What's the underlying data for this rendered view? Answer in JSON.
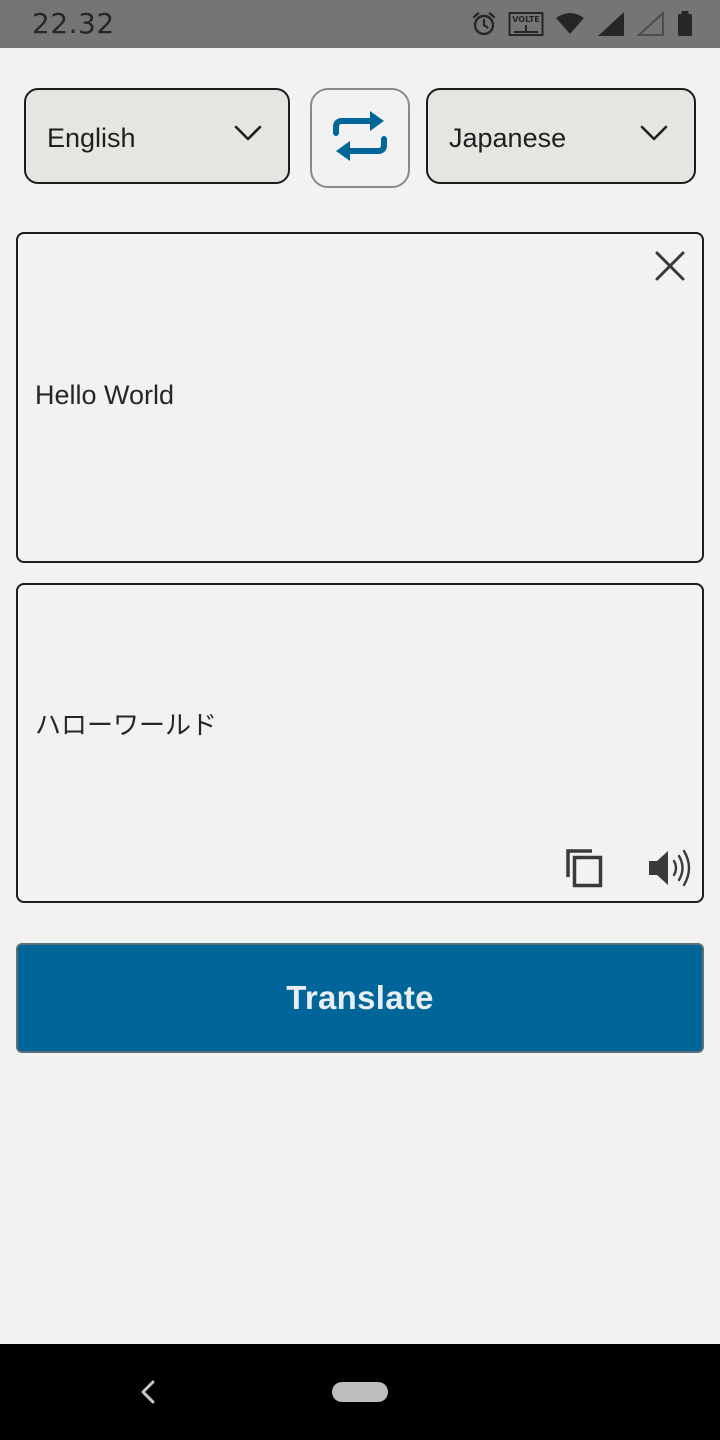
{
  "status_bar": {
    "time": "22.32",
    "icons": [
      "alarm-icon",
      "volte-icon",
      "wifi-icon",
      "signal-icon",
      "signal-empty-icon",
      "battery-icon"
    ],
    "volte_label": "VOLTE"
  },
  "languages": {
    "source": "English",
    "target": "Japanese"
  },
  "input": {
    "text": "Hello World"
  },
  "output": {
    "text": "ハローワールド"
  },
  "actions": {
    "translate_label": "Translate"
  },
  "colors": {
    "accent": "#006699",
    "background": "#f2f2f2",
    "select_background": "#e6e5e1"
  }
}
